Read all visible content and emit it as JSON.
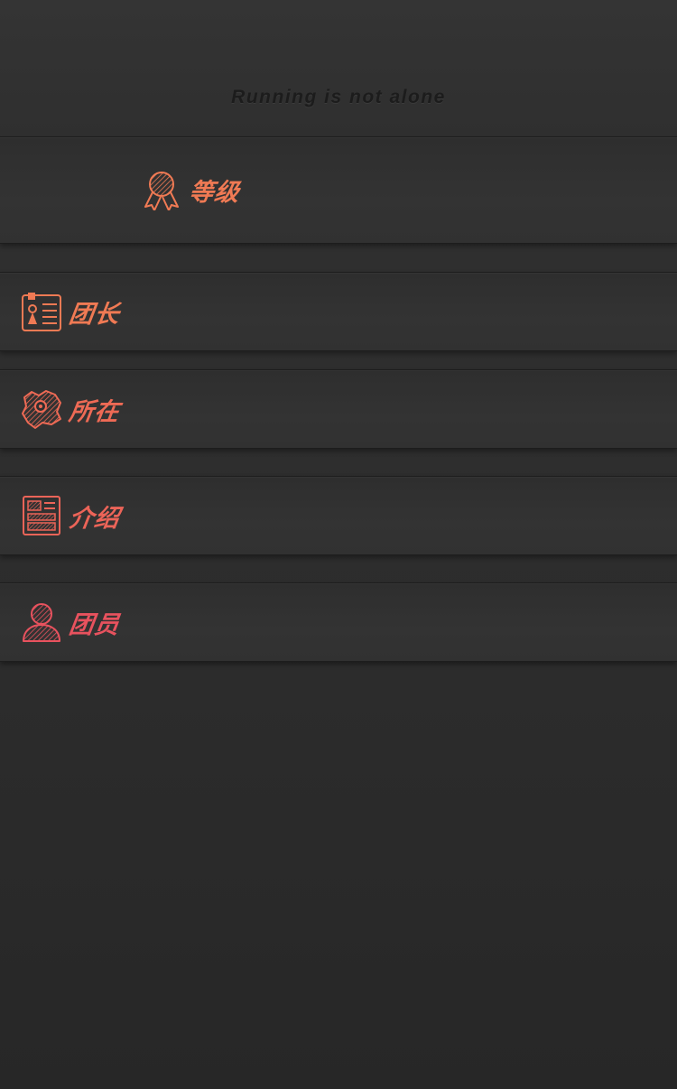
{
  "header": {
    "slogan": "Running is not alone"
  },
  "menu": {
    "level": {
      "label": "等级",
      "icon": "medal-icon",
      "color": "#f07a54"
    },
    "leader": {
      "label": "团长",
      "icon": "id-badge-icon",
      "color": "#f07a54"
    },
    "location": {
      "label": "所在",
      "icon": "map-pin-icon",
      "color": "#ee6a55"
    },
    "intro": {
      "label": "介绍",
      "icon": "document-icon",
      "color": "#ec6458"
    },
    "members": {
      "label": "团员",
      "icon": "user-icon",
      "color": "#e8525e"
    }
  },
  "colors": {
    "background": "#2c2c2c",
    "band": "#323232",
    "slogan_text": "#1c1c1c"
  }
}
